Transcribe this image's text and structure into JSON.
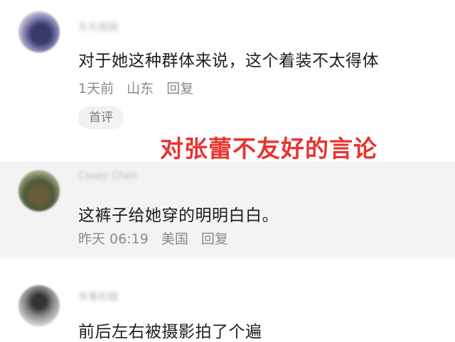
{
  "comments": [
    {
      "username": "乐乐困困",
      "text": "对于她这种群体来说，这个着装不太得体",
      "time": "1天前",
      "location": "山东",
      "reply": "回复",
      "tag": "首评"
    },
    {
      "username": "Casey Chen",
      "text": "这裤子给她穿的明明白白。",
      "time": "昨天 06:19",
      "location": "美国",
      "reply": "回复"
    },
    {
      "username": "世事如烟",
      "text": "前后左右被摄影拍了个遍"
    }
  ],
  "overlay_caption": "对张蕾不友好的言论",
  "colors": {
    "overlay": "#e8332f",
    "highlight_row": "#f3f3f3",
    "meta_text": "#8a8a8a"
  }
}
